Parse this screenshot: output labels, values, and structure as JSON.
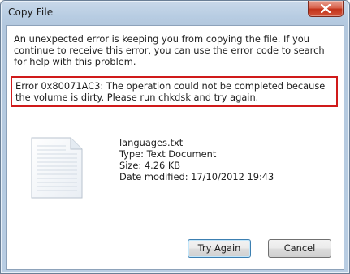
{
  "window": {
    "title": "Copy File"
  },
  "message": "An unexpected error is keeping you from copying the file. If you continue to receive this error, you can use the error code to search for help with this problem.",
  "error": "Error 0x80071AC3: The operation could not be completed because the volume is dirty. Please run chkdsk and try again.",
  "file": {
    "name": "languages.txt",
    "type": "Type: Text Document",
    "size": "Size: 4.26 KB",
    "modified": "Date modified: 17/10/2012 19:43",
    "icon": "text-document-icon"
  },
  "buttons": {
    "try_again": "Try Again",
    "cancel": "Cancel"
  },
  "colors": {
    "error_border": "#d01a1a",
    "close_button": "#c2331a",
    "default_button_border": "#3c7fb1"
  }
}
